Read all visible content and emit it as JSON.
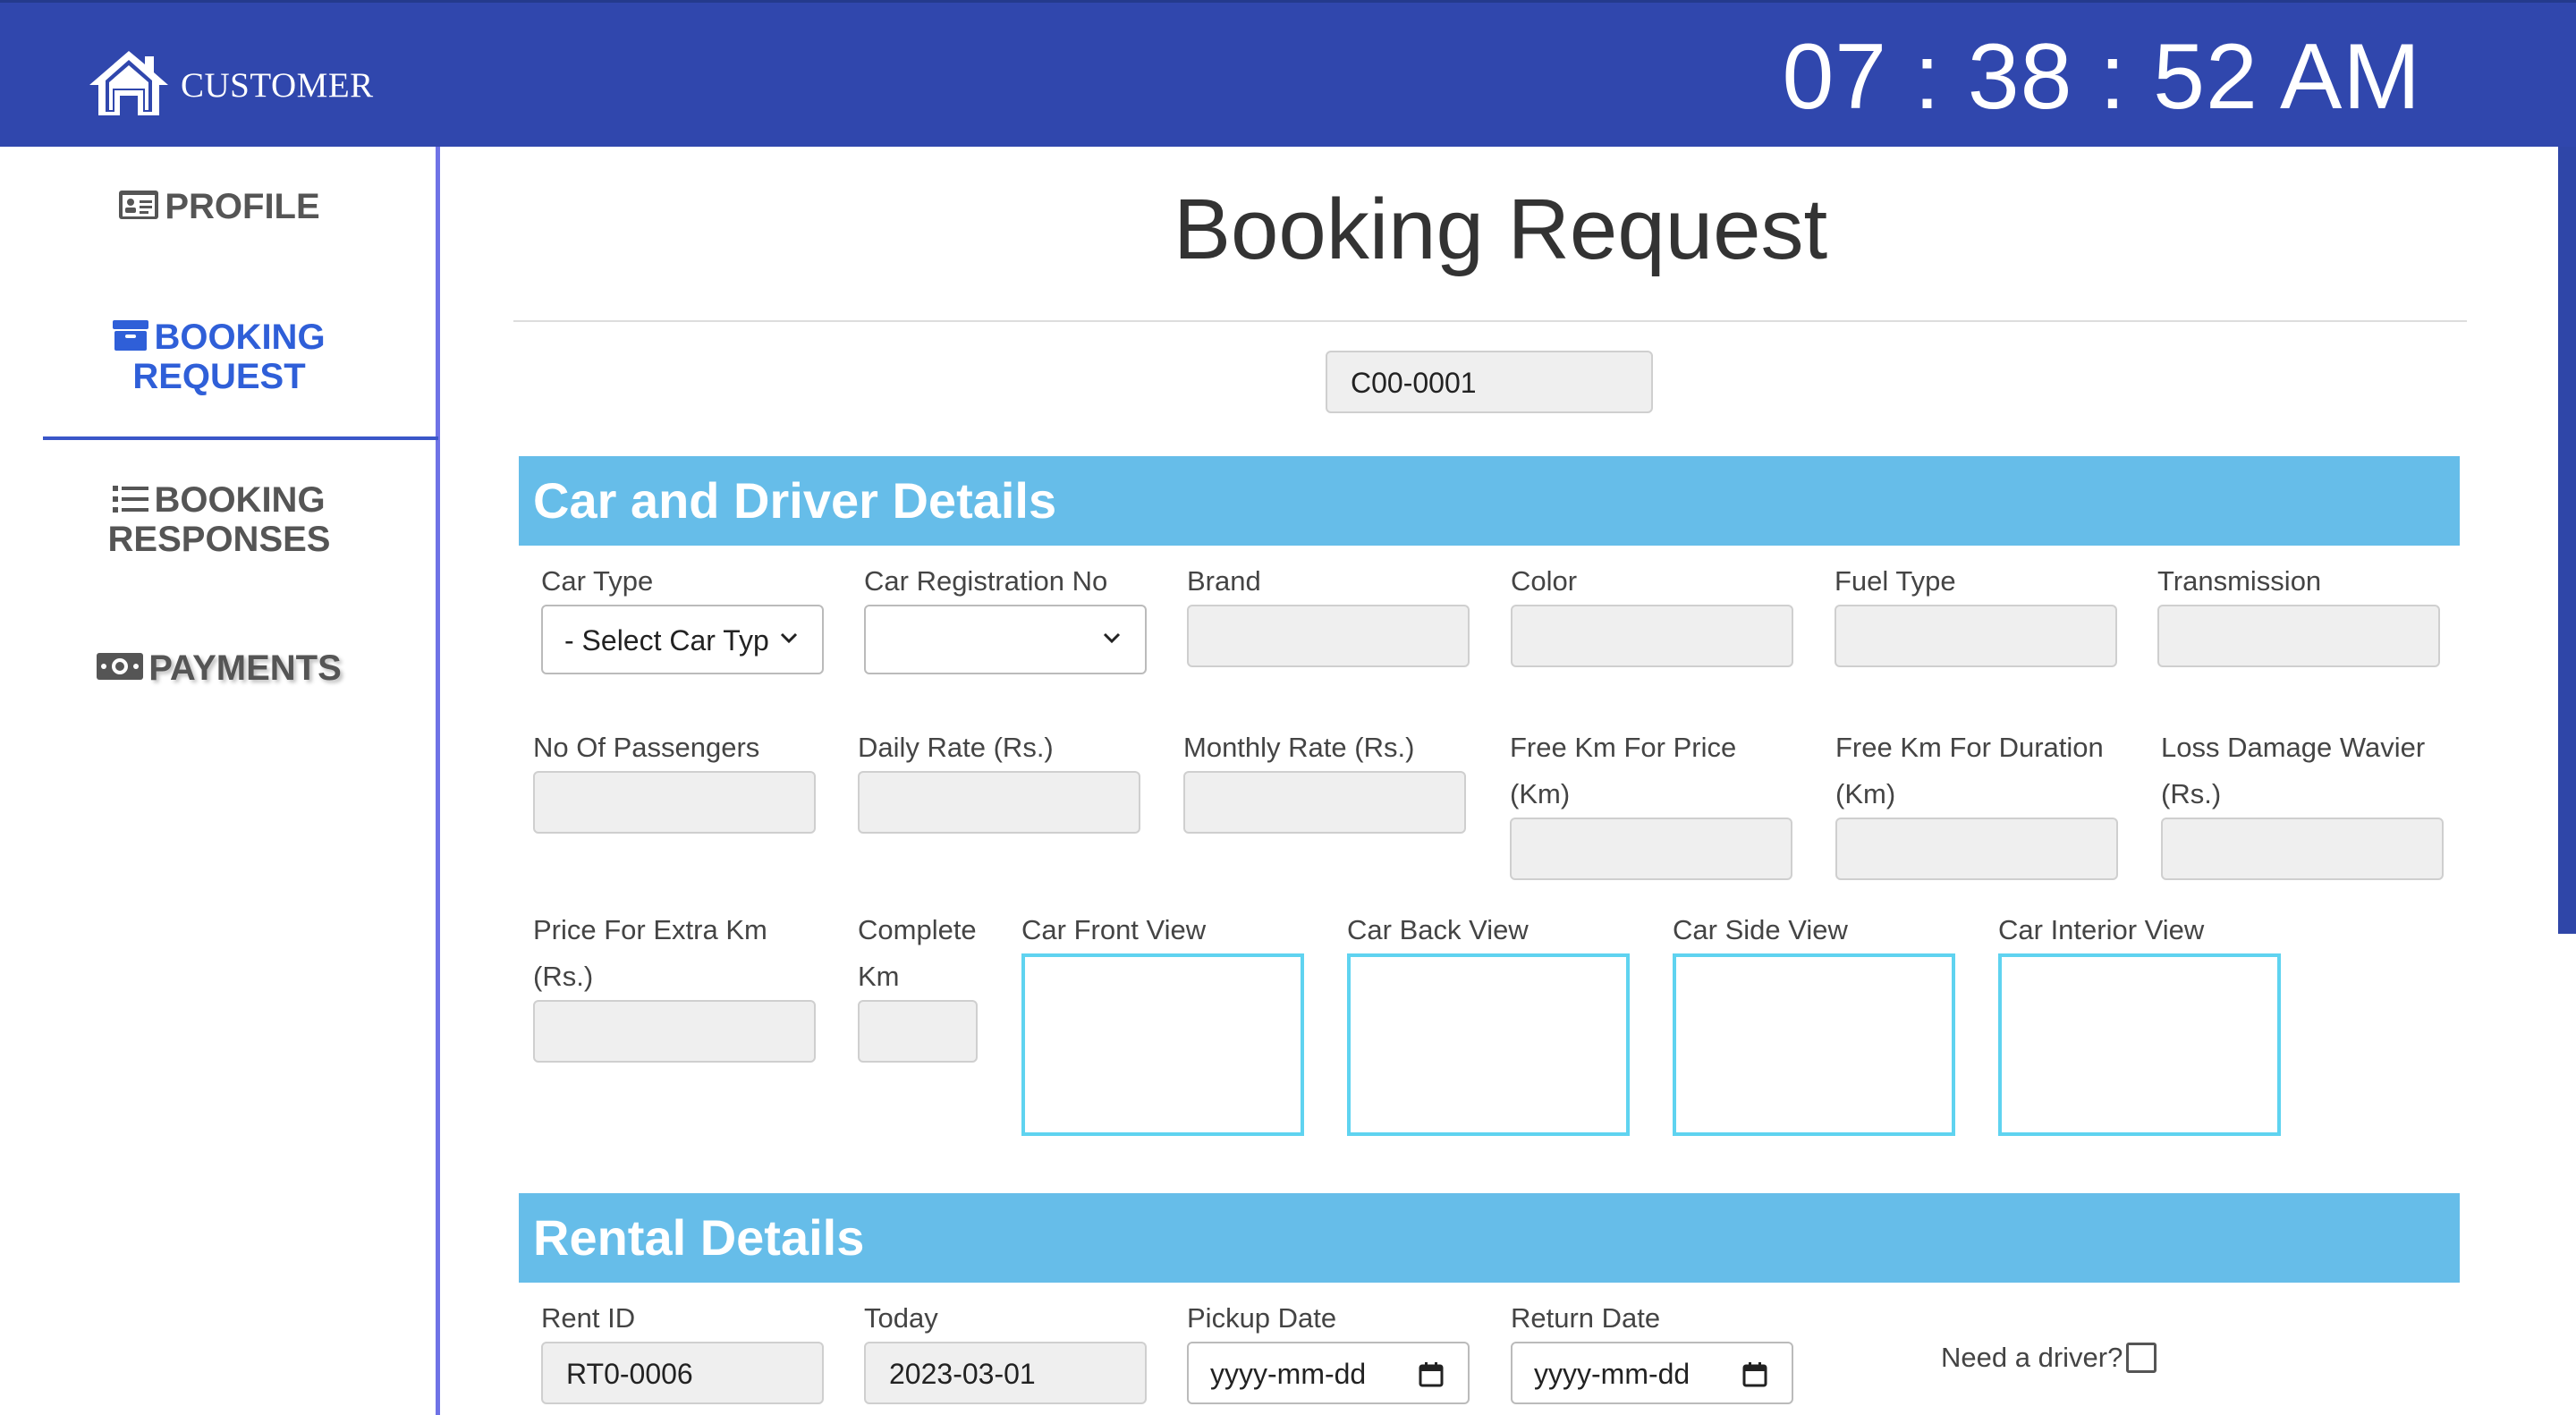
{
  "header": {
    "brand_label": "CUSTOMER",
    "clock": "07 : 38 : 52 AM"
  },
  "sidebar": {
    "items": [
      {
        "label": "PROFILE",
        "icon": "id-card-icon"
      },
      {
        "label_line1": "BOOKING",
        "label_line2": "REQUEST",
        "icon": "archive-box-icon",
        "active": true
      },
      {
        "label_line1": "BOOKING",
        "label_line2": "RESPONSES",
        "icon": "list-icon"
      },
      {
        "label": "PAYMENTS",
        "icon": "money-icon"
      }
    ]
  },
  "main": {
    "title": "Booking Request",
    "customer_id": "C00-0001",
    "car_section": {
      "heading": "Car and Driver Details",
      "car_type": {
        "label": "Car Type",
        "value": "- Select Car Typ"
      },
      "car_reg": {
        "label": "Car Registration No",
        "value": ""
      },
      "brand": {
        "label": "Brand"
      },
      "color": {
        "label": "Color"
      },
      "fuel": {
        "label": "Fuel Type"
      },
      "transmission": {
        "label": "Transmission"
      },
      "passengers": {
        "label": "No Of Passengers"
      },
      "daily_rate": {
        "label": "Daily Rate (Rs.)"
      },
      "monthly_rate": {
        "label": "Monthly Rate (Rs.)"
      },
      "free_km_price": {
        "label_line1": "Free Km For Price",
        "label_line2": "(Km)"
      },
      "free_km_duration": {
        "label_line1": "Free Km For Duration",
        "label_line2": "(Km)"
      },
      "ldw": {
        "label_line1": "Loss Damage Wavier",
        "label_line2": "(Rs.)"
      },
      "extra_km": {
        "label_line1": "Price For Extra Km",
        "label_line2": "(Rs.)"
      },
      "complete_km": {
        "label_line1": "Complete",
        "label_line2": "Km"
      },
      "front_view": {
        "label": "Car Front View"
      },
      "back_view": {
        "label": "Car Back View"
      },
      "side_view": {
        "label": "Car Side View"
      },
      "interior_view": {
        "label": "Car Interior View"
      }
    },
    "rental_section": {
      "heading": "Rental Details",
      "rent_id": {
        "label": "Rent ID",
        "value": "RT0-0006"
      },
      "today": {
        "label": "Today",
        "value": "2023-03-01"
      },
      "pickup": {
        "label": "Pickup Date",
        "placeholder": "yyyy-mm-dd"
      },
      "return": {
        "label": "Return Date",
        "placeholder": "yyyy-mm-dd"
      },
      "need_driver": {
        "label": "Need a driver?",
        "checked": false
      }
    }
  },
  "colors": {
    "topbar": "#3047ad",
    "section_bar": "#66bde9",
    "active_nav": "#2f5fd8",
    "image_border": "#5fd3f0"
  }
}
